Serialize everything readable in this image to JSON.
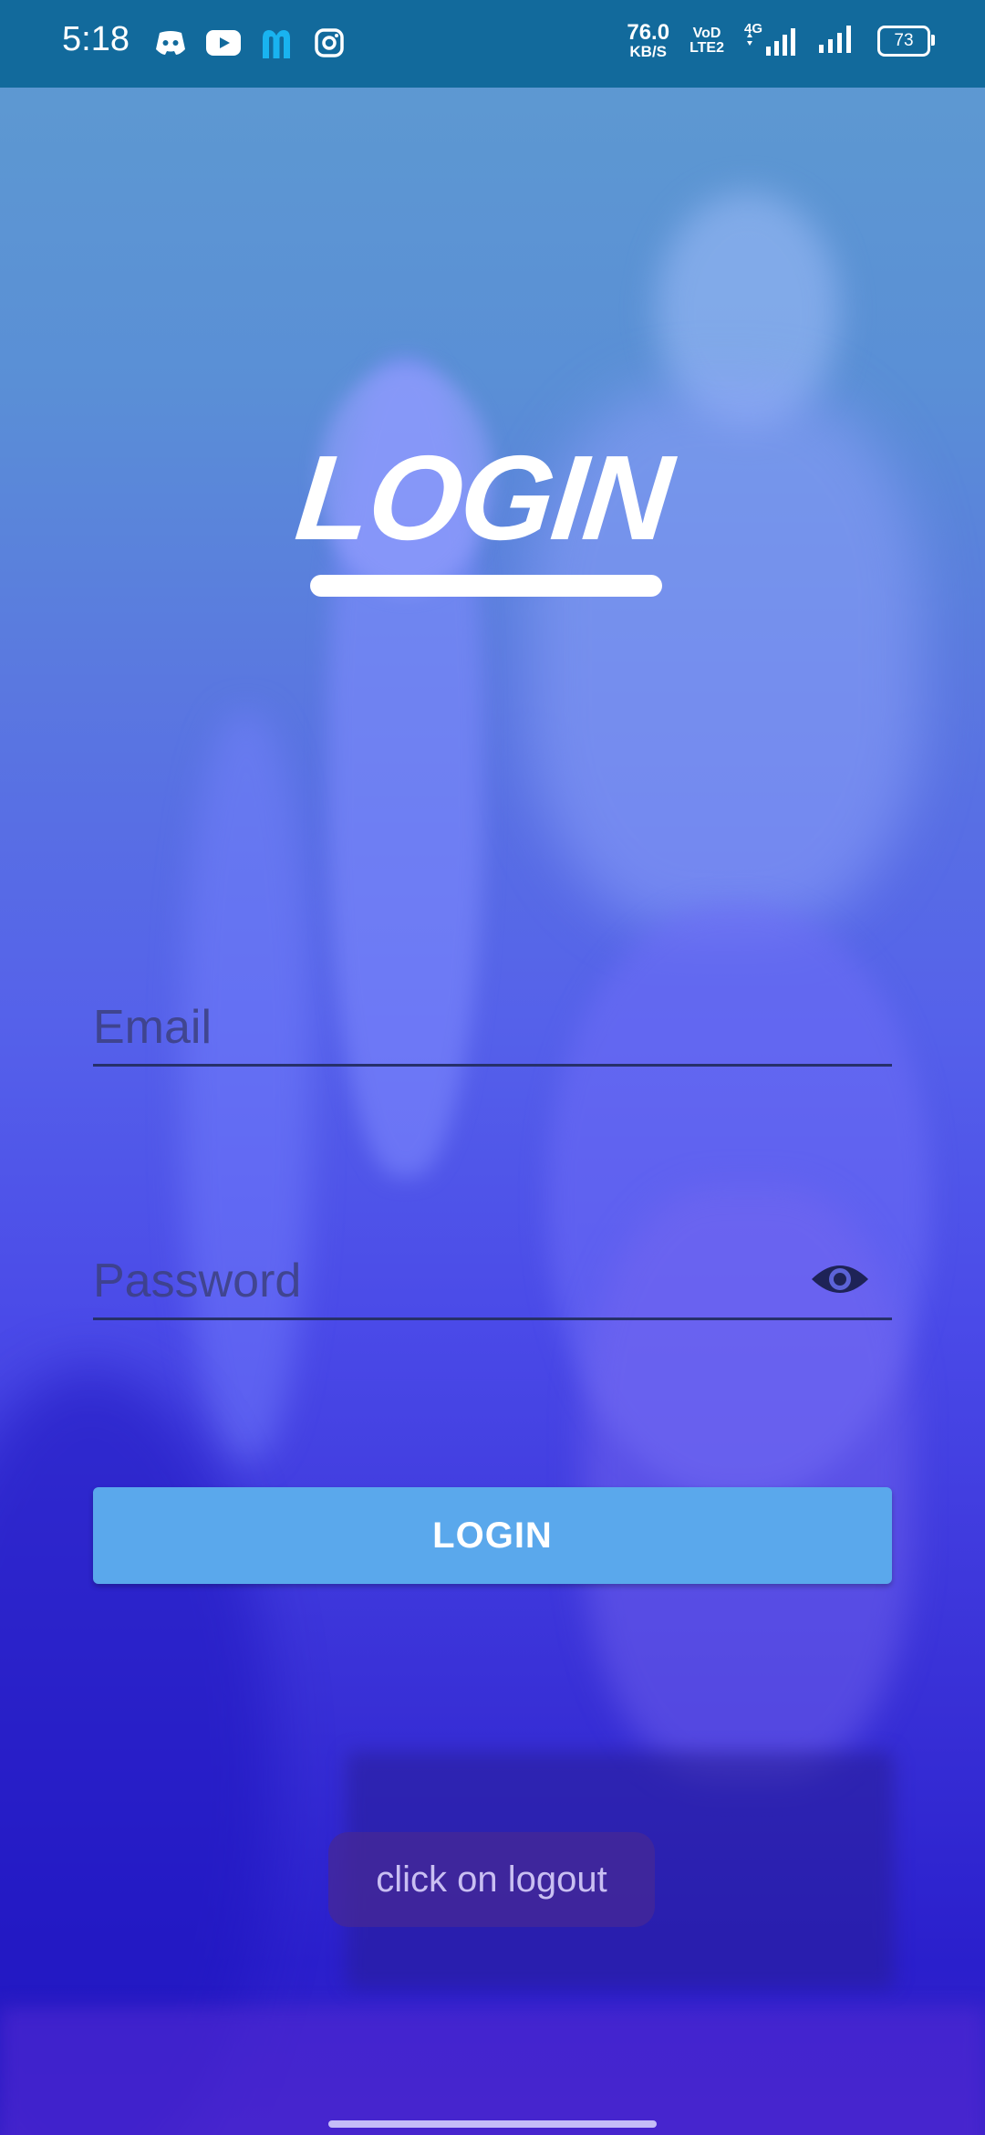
{
  "status_bar": {
    "time": "5:18",
    "notification_icons": [
      "discord-icon",
      "youtube-icon",
      "m-app-icon",
      "instagram-icon"
    ],
    "net_speed_value": "76.0",
    "net_speed_unit": "KB/S",
    "volte_top": "VoD",
    "volte_bottom": "LTE2",
    "network_type": "4G",
    "battery_level": "73"
  },
  "login_screen": {
    "title": "LOGIN",
    "email": {
      "placeholder": "Email",
      "value": ""
    },
    "password": {
      "placeholder": "Password",
      "value": ""
    },
    "login_button_label": "LOGIN"
  },
  "toast": {
    "message": "click on logout"
  },
  "colors": {
    "status_bar": "#126a9c",
    "button": "#5aa8ec",
    "field_line": "#26306a"
  }
}
